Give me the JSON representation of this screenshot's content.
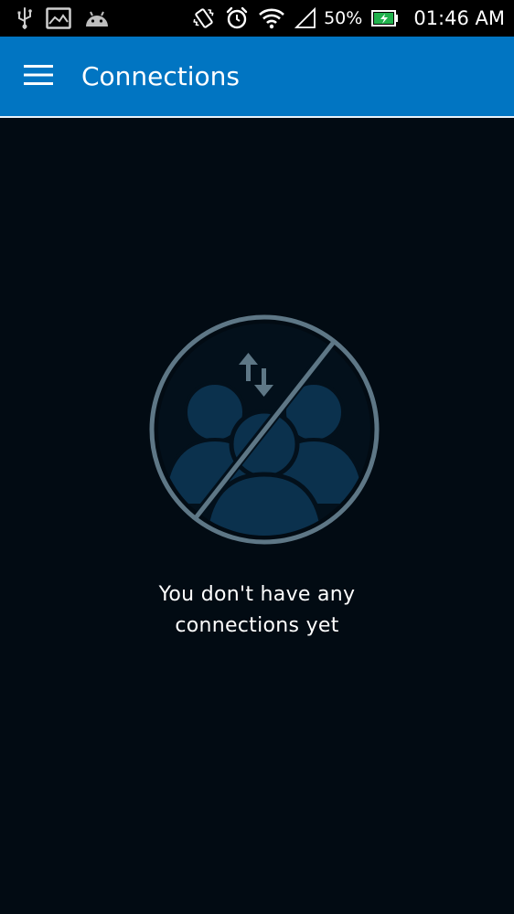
{
  "status_bar": {
    "battery_percent": "50%",
    "time": "01:46 AM",
    "icons": [
      "usb-icon",
      "image-icon",
      "android-icon",
      "vibrate-icon",
      "alarm-icon",
      "wifi-icon",
      "cellular-signal-icon",
      "battery-charging-icon"
    ]
  },
  "app_bar": {
    "title": "Connections",
    "menu_icon": "hamburger-menu-icon",
    "background_color": "#0175c2"
  },
  "empty_state": {
    "icon": "no-connections-icon",
    "message_line1": "You don't have any",
    "message_line2": "connections yet"
  },
  "colors": {
    "background": "#020b13",
    "accent": "#0175c2",
    "illustration_stroke": "#5e7786",
    "illustration_fill": "#0b314d"
  }
}
